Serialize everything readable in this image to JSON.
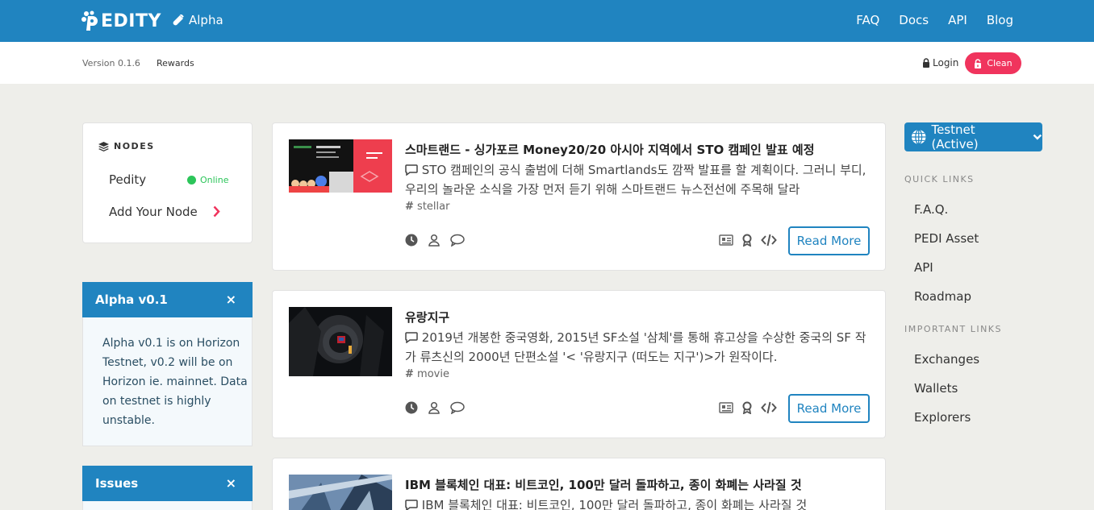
{
  "brand": {
    "name": "EDITY",
    "env_label": "Alpha"
  },
  "nav": {
    "links": [
      "FAQ",
      "Docs",
      "API",
      "Blog"
    ]
  },
  "subbar": {
    "version": "Version 0.1.6",
    "rewards": "Rewards",
    "login": "Login",
    "clean": "Clean"
  },
  "nodes": {
    "title": "NODES",
    "items": [
      {
        "label": "Pedity",
        "status": "Online"
      },
      {
        "label": "Add Your Node"
      }
    ]
  },
  "panels": [
    {
      "title": "Alpha v0.1",
      "close": "×",
      "body": "Alpha v0.1 is on Horizon Testnet, v0.2 will be on Horizon ie. mainnet. Data on testnet is highly unstable."
    },
    {
      "title": "Issues",
      "close": "×"
    }
  ],
  "posts": [
    {
      "title": "스마트랜드 - 싱가포르 Money20/20 아시아 지역에서 STO 캠페인 발표 예정",
      "desc": "STO 캠페인의 공식 출범에 더해 Smartlands도 깜짝 발표를 할 계획이다. 그러니 부디, 우리의 놀라운 소식을 가장 먼저 듣기 위해 스마트랜드 뉴스전선에 주목해 달라",
      "tag": "stellar",
      "read_more": "Read More"
    },
    {
      "title": "유랑지구",
      "desc": "2019년 개봉한 중국영화, 2015년 SF소설 '삼체'를 통해 휴고상을 수상한 중국의 SF 작가 류츠신의 2000년 단편소설 '< '유랑지구 (떠도는 지구')>가 원작이다.",
      "tag": "movie",
      "read_more": "Read More"
    },
    {
      "title": "IBM 블록체인 대표: 비트코인, 100만 달러 돌파하고, 종이 화폐는 사라질 것",
      "desc": "IBM 블록체인 대표: 비트코인, 100만 달러 돌파하고, 종이 화폐는 사라질 것"
    }
  ],
  "right": {
    "network": "Testnet (Active)",
    "quick_links_label": "QUICK LINKS",
    "quick_links": [
      "F.A.Q.",
      "PEDI Asset",
      "API",
      "Roadmap"
    ],
    "important_links_label": "IMPORTANT LINKS",
    "important_links": [
      "Exchanges",
      "Wallets",
      "Explorers"
    ]
  },
  "colors": {
    "primary": "#2084c0",
    "accent": "#f0345d",
    "online": "#2cc55a"
  }
}
